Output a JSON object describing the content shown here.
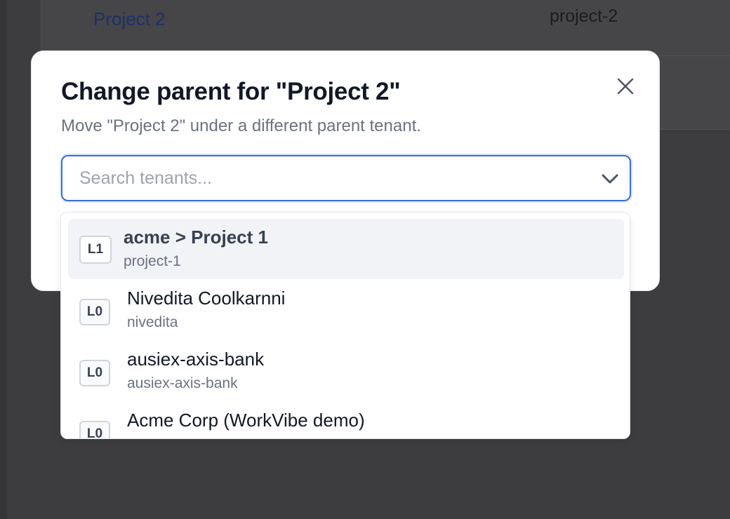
{
  "background": {
    "row_link": "Project 2",
    "row_slug": "project-2"
  },
  "dialog": {
    "title": "Change parent for \"Project 2\"",
    "description": "Move \"Project 2\" under a different parent tenant.",
    "search": {
      "placeholder": "Search tenants...",
      "value": ""
    },
    "close_icon": "close-icon",
    "chevron_icon": "chevron-down-icon"
  },
  "dropdown": {
    "options": [
      {
        "level": "L1",
        "name": "acme > Project 1",
        "slug": "project-1",
        "active": true
      },
      {
        "level": "L0",
        "name": "Nivedita Coolkarnni",
        "slug": "nivedita",
        "active": false
      },
      {
        "level": "L0",
        "name": "ausiex-axis-bank",
        "slug": "ausiex-axis-bank",
        "active": false
      },
      {
        "level": "L0",
        "name": "Acme Corp (WorkVibe demo)",
        "slug": "",
        "active": false
      }
    ]
  },
  "colors": {
    "accent": "#3b6fd1",
    "title": "#111827",
    "muted": "#6b7280",
    "overlay": "#3d3d3f",
    "active_option_bg": "#f1f3f7"
  }
}
